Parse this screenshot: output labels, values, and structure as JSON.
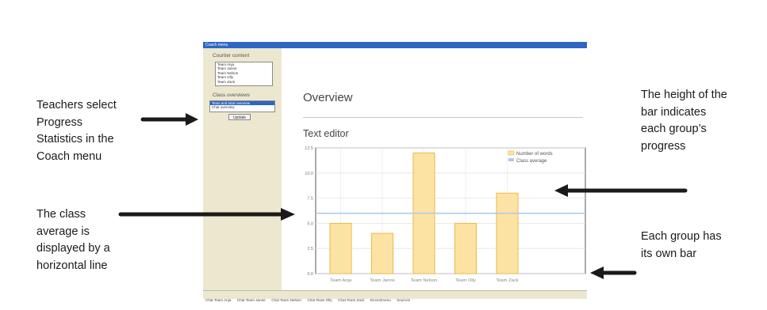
{
  "window": {
    "title": "Coach menu"
  },
  "sidebar": {
    "courtier_heading": "Courtier content",
    "teams": [
      "Team Anja",
      "Team Janne",
      "Team Nelson",
      "Team Olly",
      "Team Zack"
    ],
    "class_heading": "Class overviews",
    "overviews": [
      "Texts and total overview",
      "Chat overview"
    ],
    "selected_overview": 0,
    "update_label": "Update"
  },
  "main": {
    "title": "Overview",
    "section": "Text editor"
  },
  "chart_data": {
    "type": "bar",
    "categories": [
      "Team Anja",
      "Team Janne",
      "Team Nelson",
      "Team Olly",
      "Team Zack"
    ],
    "series": [
      {
        "name": "Number of words",
        "values": [
          5.0,
          4.0,
          12.0,
          5.0,
          8.0
        ]
      }
    ],
    "reference_line": {
      "name": "Class average",
      "value": 6.0
    },
    "ylim": [
      0,
      12.5
    ],
    "yticks": [
      "12.5",
      "10.0",
      "7.5",
      "5.0",
      "2.5",
      "0.0"
    ],
    "legend_position": "top-right",
    "grid": true,
    "colors": {
      "bar_fill": "#fde3a3",
      "bar_stroke": "#e9b947",
      "average_line": "#a9cde8"
    }
  },
  "tabs": [
    "Chat Team Anja",
    "Chat Team Janne",
    "Chat Team Nelson",
    "Chat Team Olly",
    "Chat Team Zack",
    "Encentmenu",
    "Sources"
  ],
  "annotations": {
    "left_top": [
      "Teachers select",
      "Progress",
      "Statistics in the",
      "Coach menu"
    ],
    "left_bottom": [
      "The class",
      "average is",
      "displayed by a",
      "horizontal line"
    ],
    "right_top": [
      "The height of the",
      "bar indicates",
      "each group’s",
      "progress"
    ],
    "right_bottom": [
      "Each group has",
      "its own bar"
    ]
  }
}
